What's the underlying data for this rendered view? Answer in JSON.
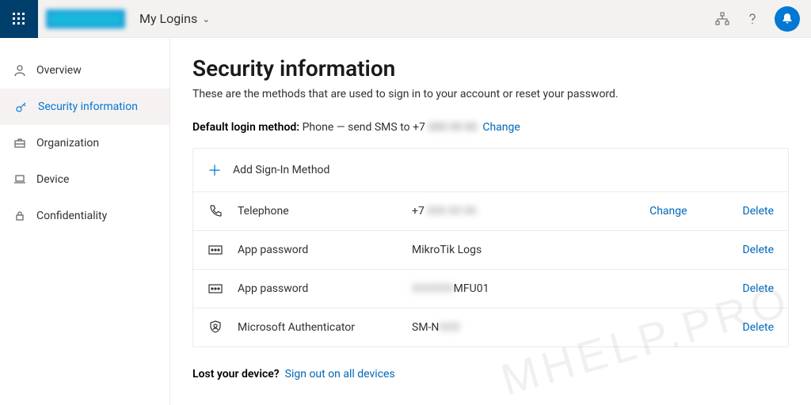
{
  "header": {
    "title": "My Logins"
  },
  "sidebar": {
    "items": [
      {
        "label": "Overview"
      },
      {
        "label": "Security information"
      },
      {
        "label": "Organization"
      },
      {
        "label": "Device"
      },
      {
        "label": "Confidentiality"
      }
    ]
  },
  "page": {
    "heading": "Security information",
    "subtitle": "These are the methods that are used to sign in to your account or reset your password.",
    "default_label": "Default login method:",
    "default_method_prefix": "Phone — send SMS to +7 ",
    "default_method_masked": "000 00 00",
    "change": "Change",
    "add_method": "Add Sign-In Method",
    "methods": [
      {
        "name": "Telephone",
        "value_prefix": "+7 ",
        "value_masked": "000 00 00",
        "change": "Change",
        "delete": "Delete"
      },
      {
        "name": "App password",
        "value": "MikroTik Logs",
        "delete": "Delete"
      },
      {
        "name": "App password",
        "value_masked": "XXXXXX",
        "value_suffix": "MFU01",
        "delete": "Delete"
      },
      {
        "name": "Microsoft Authenticator",
        "value_prefix": "SM-N",
        "value_masked": "XXX",
        "delete": "Delete"
      }
    ],
    "lost_label": "Lost your device?",
    "lost_link": "Sign out on all devices"
  },
  "watermark": "MHELP.PRO"
}
